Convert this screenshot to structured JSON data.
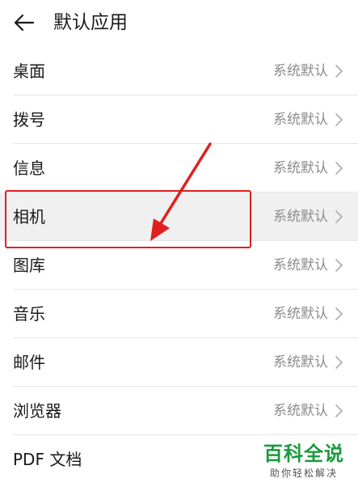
{
  "header": {
    "title": "默认应用",
    "back_icon": "arrow-left-icon"
  },
  "list": {
    "items": [
      {
        "label": "桌面",
        "value": "系统默认"
      },
      {
        "label": "拨号",
        "value": "系统默认"
      },
      {
        "label": "信息",
        "value": "系统默认"
      },
      {
        "label": "相机",
        "value": "系统默认"
      },
      {
        "label": "图库",
        "value": "系统默认"
      },
      {
        "label": "音乐",
        "value": "系统默认"
      },
      {
        "label": "邮件",
        "value": "系统默认"
      },
      {
        "label": "浏览器",
        "value": "系统默认"
      },
      {
        "label": "PDF 文档",
        "value": ""
      }
    ]
  },
  "annotation": {
    "color": "#e02020"
  },
  "watermark": {
    "title": "百科全说",
    "subtitle": "助你轻松解决",
    "color": "#1a9b3c"
  }
}
